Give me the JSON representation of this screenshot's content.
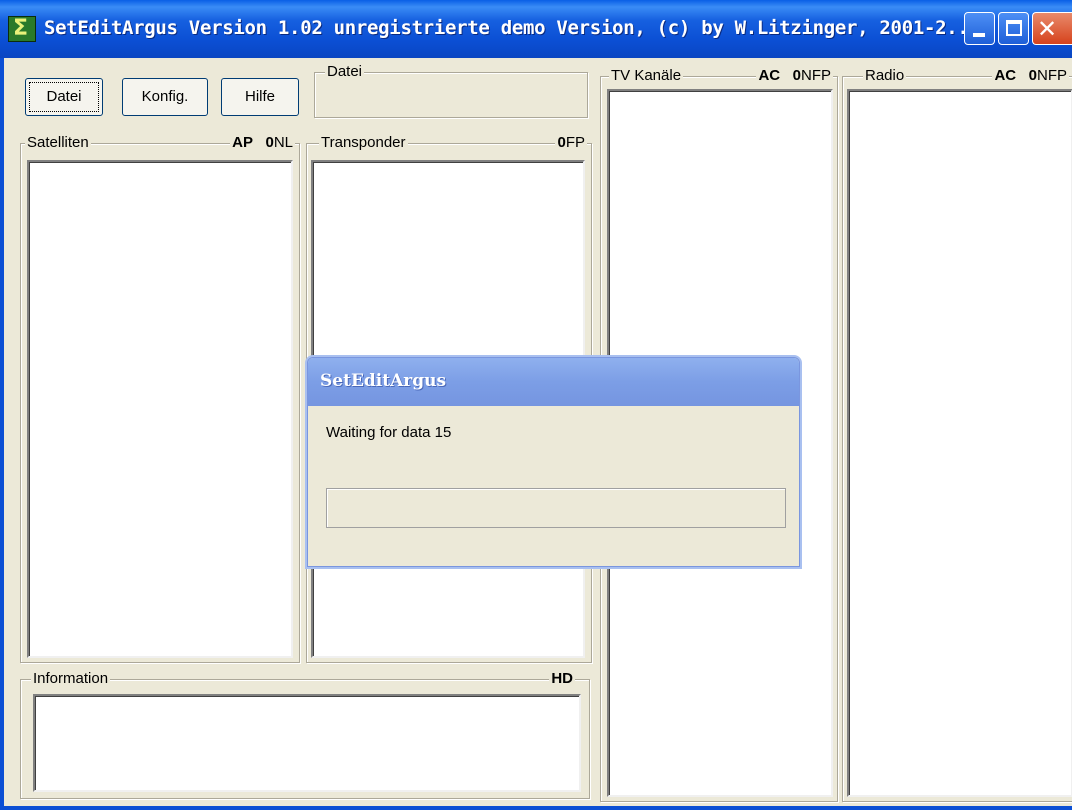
{
  "window": {
    "title": "SetEditArgus Version  1.02  unregistrierte demo Version, (c) by W.Litzinger, 2001-2..."
  },
  "toolbar": {
    "datei_label": "Datei",
    "konfig_label": "Konfig.",
    "hilfe_label": "Hilfe"
  },
  "groups": {
    "datei": {
      "label": "Datei"
    },
    "satelliten": {
      "label": "Satelliten",
      "code_bold": "AP",
      "code_bold2": "0",
      "code_rest": "NL"
    },
    "transponder": {
      "label": "Transponder",
      "code_bold": "0",
      "code_rest": "FP"
    },
    "information": {
      "label": "Information",
      "code_bold": "HD"
    },
    "tv": {
      "label": "TV Kanäle",
      "code_bold": "AC",
      "code_bold2": "0",
      "code_rest": "NFP"
    },
    "radio": {
      "label": "Radio",
      "code_bold": "AC",
      "code_bold2": "0",
      "code_rest": "NFP"
    }
  },
  "dialog": {
    "title": "SetEditArgus",
    "message": "Waiting for data 15",
    "progress": 0
  },
  "colors": {
    "titlebar": "#0b4fd4",
    "dialog_title": "#7c9ee6",
    "window_bg": "#ece9d8"
  }
}
